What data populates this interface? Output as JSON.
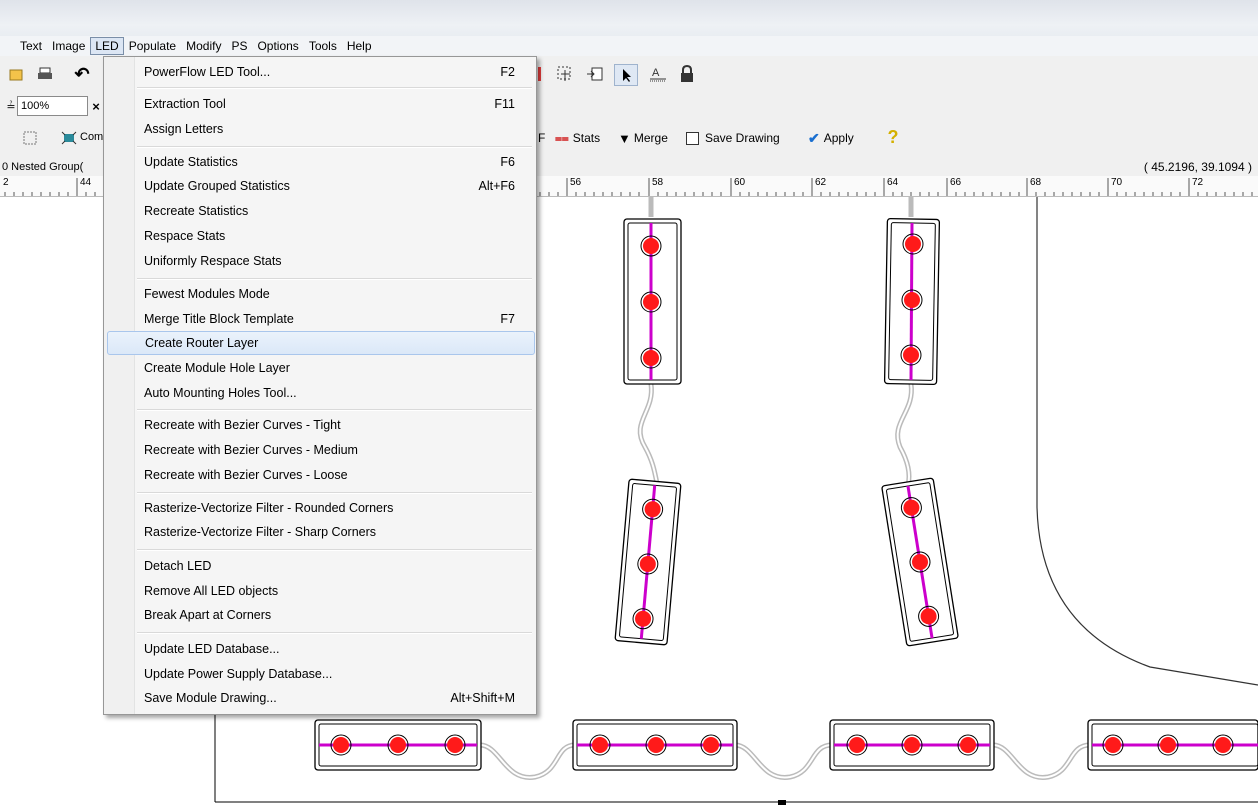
{
  "menubar": {
    "items": [
      "Text",
      "Image",
      "LED",
      "Populate",
      "Modify",
      "PS",
      "Options",
      "Tools",
      "Help"
    ],
    "active": "LED"
  },
  "toolbar": {
    "zoom_value": "100%",
    "partial_label": "Com",
    "stats_label": "Stats",
    "merge_label": "Merge",
    "save_drawing_label": "Save Drawing",
    "apply_label": "Apply",
    "f_label": "F"
  },
  "status": {
    "left_text": "0 Nested Group(",
    "coordinates": "( 45.2196,  39.1094 )"
  },
  "ruler": {
    "left_labels": [
      "2",
      "44"
    ],
    "labels": [
      "56",
      "58",
      "60",
      "62",
      "64",
      "66",
      "68",
      "70",
      "72"
    ]
  },
  "led_menu": {
    "items": [
      {
        "label": "PowerFlow LED Tool...",
        "shortcut": "F2"
      },
      {
        "label": "Extraction Tool",
        "shortcut": "F11"
      },
      {
        "label": "Assign Letters",
        "shortcut": ""
      },
      {
        "label": "Update Statistics",
        "shortcut": "F6"
      },
      {
        "label": "Update Grouped Statistics",
        "shortcut": "Alt+F6"
      },
      {
        "label": "Recreate Statistics",
        "shortcut": ""
      },
      {
        "label": "Respace Stats",
        "shortcut": ""
      },
      {
        "label": "Uniformly Respace Stats",
        "shortcut": ""
      },
      {
        "label": "Fewest Modules Mode",
        "shortcut": ""
      },
      {
        "label": "Merge Title Block Template",
        "shortcut": "F7"
      },
      {
        "label": "Create Router Layer",
        "shortcut": ""
      },
      {
        "label": "Create Module Hole Layer",
        "shortcut": ""
      },
      {
        "label": "Auto Mounting Holes Tool...",
        "shortcut": ""
      },
      {
        "label": "Recreate with Bezier Curves - Tight",
        "shortcut": ""
      },
      {
        "label": "Recreate with Bezier Curves - Medium",
        "shortcut": ""
      },
      {
        "label": "Recreate with Bezier Curves - Loose",
        "shortcut": ""
      },
      {
        "label": "Rasterize-Vectorize Filter - Rounded Corners",
        "shortcut": ""
      },
      {
        "label": "Rasterize-Vectorize Filter - Sharp Corners",
        "shortcut": ""
      },
      {
        "label": "Detach LED",
        "shortcut": ""
      },
      {
        "label": "Remove All LED objects",
        "shortcut": ""
      },
      {
        "label": "Break Apart at Corners",
        "shortcut": ""
      },
      {
        "label": "Update LED Database...",
        "shortcut": ""
      },
      {
        "label": "Update Power Supply Database...",
        "shortcut": ""
      },
      {
        "label": "Save Module Drawing...",
        "shortcut": "Alt+Shift+M"
      }
    ],
    "highlighted": "Create Router Layer"
  },
  "colors": {
    "led": "#ff1a1a",
    "wire": "#cc00cc",
    "highlight": "#dbe8f8"
  }
}
